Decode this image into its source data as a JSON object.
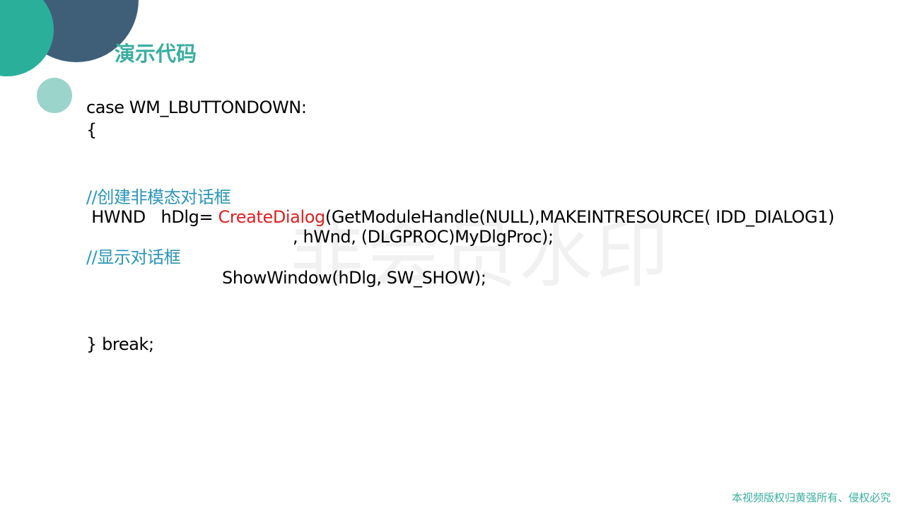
{
  "slide": {
    "title": "演示代码",
    "watermark": "非会员水印",
    "footer": "本视频版权归黄强所有、侵权必究"
  },
  "code": {
    "line1": "case WM_LBUTTONDOWN:",
    "line2": "{",
    "comment1": "//创建非模态对话框",
    "line3_prefix": " HWND   hDlg= ",
    "line3_fn": "CreateDialog",
    "line3_suffix": "(GetModuleHandle(NULL),MAKEINTRESOURCE( IDD_DIALOG1)",
    "line4": ", hWnd, (DLGPROC)MyDlgProc);",
    "comment2": "//显示对话框",
    "line5": "ShowWindow(hDlg, SW_SHOW);",
    "line6": "} break;"
  },
  "colors": {
    "accent_teal": "#2ab09a",
    "accent_dark": "#3f5f79",
    "accent_light": "#9bd4ca",
    "title": "#3aaea0",
    "comment": "#2b95b8",
    "function": "#e02020"
  }
}
